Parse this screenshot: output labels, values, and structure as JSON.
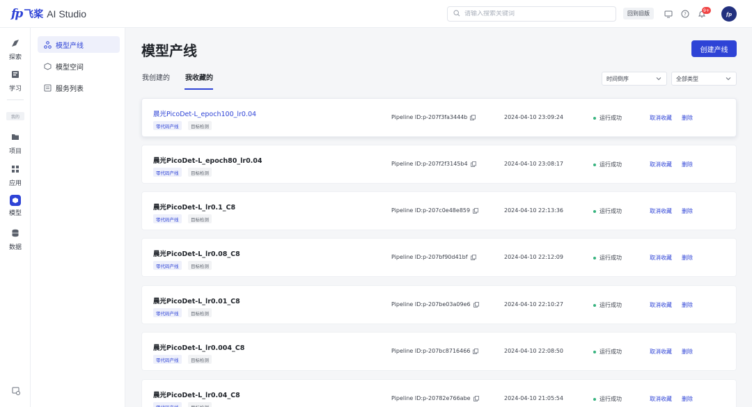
{
  "brand": {
    "mark": "fp",
    "cn": "飞桨",
    "en": "AI Studio"
  },
  "header": {
    "search_placeholder": "请输入搜索关键词",
    "old_version_label": "回到旧版",
    "notification_badge": "9+",
    "avatar_text": "fp"
  },
  "rail": {
    "items": [
      {
        "label": "探索",
        "icon": "compass-icon"
      },
      {
        "label": "学习",
        "icon": "book-icon"
      },
      {
        "label": "项目",
        "icon": "folder-icon"
      },
      {
        "label": "应用",
        "icon": "apps-icon"
      },
      {
        "label": "模型",
        "icon": "cube-icon"
      },
      {
        "label": "数据",
        "icon": "database-icon"
      }
    ],
    "section_tag": "我的",
    "active": "模型"
  },
  "subnav": {
    "items": [
      {
        "label": "模型产线",
        "icon": "pipeline-icon"
      },
      {
        "label": "模型空间",
        "icon": "cube-outline-icon"
      },
      {
        "label": "服务列表",
        "icon": "list-icon"
      }
    ],
    "active": "模型产线"
  },
  "main": {
    "title": "模型产线",
    "create_button": "创建产线",
    "tabs": [
      {
        "label": "我创建的"
      },
      {
        "label": "我收藏的"
      }
    ],
    "active_tab": "我收藏的",
    "filters": {
      "sort": "时间倒序",
      "type": "全部类型"
    },
    "accent_color": "#2e43d6",
    "rows": [
      {
        "name": "晨光PicoDet-L_epoch100_lr0.04",
        "tags": [
          "零代码产线",
          "目标检测"
        ],
        "pipeline_id": "Pipeline ID:p-207f3fa3444b",
        "time": "2024-04-10 23:09:24",
        "status": "运行成功",
        "unfav": "取消收藏",
        "delete": "删除"
      },
      {
        "name": "晨光PicoDet-L_epoch80_lr0.04",
        "tags": [
          "零代码产线",
          "目标检测"
        ],
        "pipeline_id": "Pipeline ID:p-207f2f3145b4",
        "time": "2024-04-10 23:08:17",
        "status": "运行成功",
        "unfav": "取消收藏",
        "delete": "删除"
      },
      {
        "name": "晨光PicoDet-L_lr0.1_C8",
        "tags": [
          "零代码产线",
          "目标检测"
        ],
        "pipeline_id": "Pipeline ID:p-207c0e48e859",
        "time": "2024-04-10 22:13:36",
        "status": "运行成功",
        "unfav": "取消收藏",
        "delete": "删除"
      },
      {
        "name": "晨光PicoDet-L_lr0.08_C8",
        "tags": [
          "零代码产线",
          "目标检测"
        ],
        "pipeline_id": "Pipeline ID:p-207bf90d41bf",
        "time": "2024-04-10 22:12:09",
        "status": "运行成功",
        "unfav": "取消收藏",
        "delete": "删除"
      },
      {
        "name": "晨光PicoDet-L_lr0.01_C8",
        "tags": [
          "零代码产线",
          "目标检测"
        ],
        "pipeline_id": "Pipeline ID:p-207be03a09e6",
        "time": "2024-04-10 22:10:27",
        "status": "运行成功",
        "unfav": "取消收藏",
        "delete": "删除"
      },
      {
        "name": "晨光PicoDet-L_lr0.004_C8",
        "tags": [
          "零代码产线",
          "目标检测"
        ],
        "pipeline_id": "Pipeline ID:p-207bc8716466",
        "time": "2024-04-10 22:08:50",
        "status": "运行成功",
        "unfav": "取消收藏",
        "delete": "删除"
      },
      {
        "name": "晨光PicoDet-L_lr0.04_C8",
        "tags": [
          "零代码产线",
          "目标检测"
        ],
        "pipeline_id": "Pipeline ID:p-20782e766abe",
        "time": "2024-04-10 21:05:54",
        "status": "运行成功",
        "unfav": "取消收藏",
        "delete": "删除"
      }
    ]
  }
}
